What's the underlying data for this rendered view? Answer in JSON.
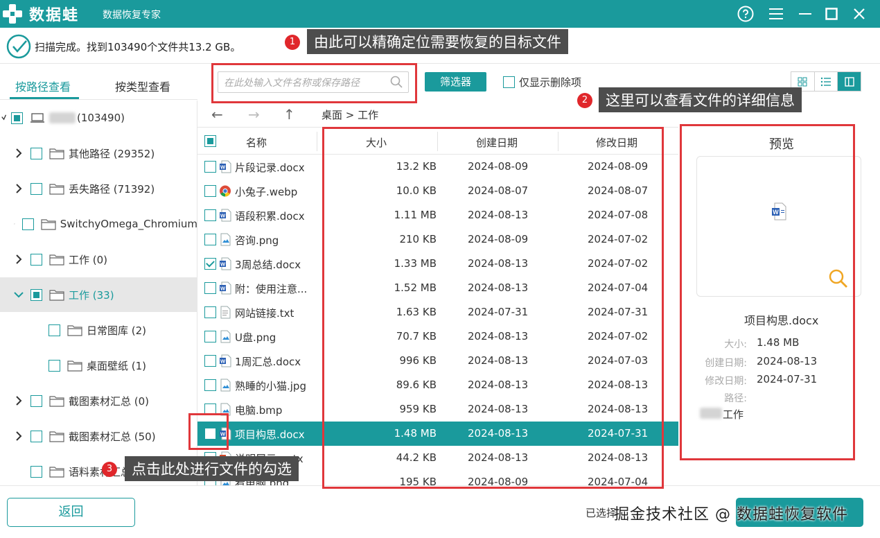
{
  "app": {
    "brand": "数据蛙",
    "subtitle": "数据恢复专家"
  },
  "scan": {
    "status": "扫描完成。找到103490个文件共13.2 GB。"
  },
  "annotations": [
    {
      "num": "1",
      "text": "由此可以精确定位需要恢复的目标文件"
    },
    {
      "num": "2",
      "text": "这里可以查看文件的详细信息"
    },
    {
      "num": "3",
      "text": "点击此处进行文件的勾选"
    }
  ],
  "left_tabs": [
    "按路径查看",
    "按类型查看"
  ],
  "tree": [
    {
      "label": "(103490)",
      "arrow": "none",
      "check": "partial",
      "icon": "computer-icon",
      "indent": 0
    },
    {
      "label": "其他路径 (29352)",
      "arrow": "right",
      "check": "none",
      "icon": "folder-icon",
      "indent": 1
    },
    {
      "label": "丢失路径 (71392)",
      "arrow": "right",
      "check": "none",
      "icon": "folder-icon",
      "indent": 1
    },
    {
      "label": "SwitchyOmega_Chromium",
      "arrow": "right",
      "check": "none",
      "icon": "folder-icon",
      "indent": 1
    },
    {
      "label": "工作 (0)",
      "arrow": "right",
      "check": "none",
      "icon": "folder-icon",
      "indent": 1
    },
    {
      "label": "工作 (33)",
      "arrow": "down",
      "check": "partial",
      "icon": "folder-icon",
      "indent": 1,
      "selected": true
    },
    {
      "label": "日常图库 (2)",
      "arrow": "none",
      "check": "none",
      "icon": "folder-icon",
      "indent": 2
    },
    {
      "label": "桌面壁纸 (1)",
      "arrow": "none",
      "check": "none",
      "icon": "folder-icon",
      "indent": 2
    },
    {
      "label": "截图素材汇总 (0)",
      "arrow": "right",
      "check": "none",
      "icon": "folder-icon",
      "indent": 1
    },
    {
      "label": "截图素材汇总 (50)",
      "arrow": "right",
      "check": "none",
      "icon": "folder-icon",
      "indent": 1
    },
    {
      "label": "语料素材汇总 (0)",
      "arrow": "none",
      "check": "none",
      "icon": "folder-icon",
      "indent": 1
    }
  ],
  "toolbar": {
    "search_placeholder": "在此处输入文件名称或保存路径",
    "filter_label": "筛选器",
    "deleted_only_label": "仅显示删除项"
  },
  "nav": {
    "back": "←",
    "forward": "→",
    "up": "↑",
    "breadcrumb": "桌面 > 工作"
  },
  "table": {
    "headers": [
      "名称",
      "大小",
      "创建日期",
      "修改日期"
    ],
    "rows": [
      {
        "name": "片段记录.docx",
        "icon": "word-icon",
        "size": "13.2 KB",
        "created": "2024-08-09",
        "modified": "2024-08-09",
        "checked": false
      },
      {
        "name": "小兔子.webp",
        "icon": "chrome-icon",
        "size": "10.0 KB",
        "created": "2024-08-07",
        "modified": "2024-08-07",
        "checked": false
      },
      {
        "name": "语段积累.docx",
        "icon": "word-icon",
        "size": "1.11 MB",
        "created": "2024-08-13",
        "modified": "2024-07-08",
        "checked": false
      },
      {
        "name": "咨询.png",
        "icon": "image-icon",
        "size": "210 KB",
        "created": "2024-08-09",
        "modified": "2024-07-02",
        "checked": false
      },
      {
        "name": "3周总结.docx",
        "icon": "word-icon",
        "size": "1.33 MB",
        "created": "2024-08-13",
        "modified": "2024-07-02",
        "checked": true
      },
      {
        "name": "附：使用注意...",
        "icon": "word-icon",
        "size": "1.52 MB",
        "created": "2024-08-13",
        "modified": "2024-07-04",
        "checked": false
      },
      {
        "name": "网站链接.txt",
        "icon": "text-icon",
        "size": "1.63 KB",
        "created": "2024-07-31",
        "modified": "2024-07-31",
        "checked": false
      },
      {
        "name": "U盘.png",
        "icon": "image-icon",
        "size": "70.7 KB",
        "created": "2024-08-13",
        "modified": "2024-07-02",
        "checked": false
      },
      {
        "name": "1周汇总.docx",
        "icon": "word-icon",
        "size": "996 KB",
        "created": "2024-08-13",
        "modified": "2024-07-03",
        "checked": false
      },
      {
        "name": "熟睡的小猫.jpg",
        "icon": "image-icon",
        "size": "89.6 KB",
        "created": "2024-08-13",
        "modified": "2024-08-13",
        "checked": false
      },
      {
        "name": "电脑.bmp",
        "icon": "image-icon",
        "size": "959 KB",
        "created": "2024-08-13",
        "modified": "2024-08-13",
        "checked": false
      },
      {
        "name": "项目构思.docx",
        "icon": "word-icon",
        "size": "1.48 MB",
        "created": "2024-08-13",
        "modified": "2024-07-31",
        "checked": false,
        "selected": true
      },
      {
        "name": "说明展示.pptx",
        "icon": "ppt-icon",
        "size": "44.2 KB",
        "created": "2024-08-13",
        "modified": "2024-08-13",
        "checked": false
      },
      {
        "name": "看电脑.png",
        "icon": "image-icon",
        "size": "195 KB",
        "created": "2024-08-09",
        "modified": "2024-07-04",
        "checked": false
      }
    ]
  },
  "preview": {
    "title": "预览",
    "file_name": "项目构思.docx",
    "size_label": "大小:",
    "size": "1.48 MB",
    "created_label": "创建日期:",
    "created": "2024-08-13",
    "modified_label": "修改日期:",
    "modified": "2024-07-31",
    "path_label": "路径:",
    "path": "工作"
  },
  "bottom": {
    "back_label": "返回",
    "selected_info": "已选择",
    "watermark": "掘金技术社区 @ 数据蛙恢复软件"
  },
  "colors": {
    "accent": "#1a9a9c",
    "annotation_red": "#e0373b",
    "annotation_bg": "#4d4d4d"
  }
}
